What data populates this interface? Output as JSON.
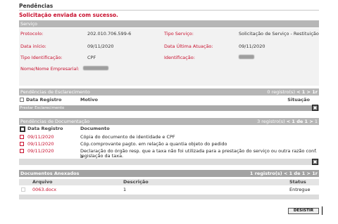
{
  "page": {
    "title": "Pendências",
    "success_message": "Solicitação enviada com sucesso."
  },
  "servico": {
    "header": "Serviço",
    "fields": {
      "protocolo_label": "Protocolo:",
      "protocolo_value": "202.010.706.599-6",
      "tipo_servico_label": "Tipo Serviço:",
      "tipo_servico_value": "Solicitação de Serviço - Restituição",
      "data_inicio_label": "Data início:",
      "data_inicio_value": "09/11/2020",
      "data_ultima_label": "Data Última Atuação:",
      "data_ultima_value": "09/11/2020",
      "tipo_ident_label": "Tipo Identificação:",
      "tipo_ident_value": "CPF",
      "identificacao_label": "Identificação:",
      "nome_label": "Nome/Nome Empresarial:"
    }
  },
  "esclarecimento": {
    "header": "Pendências de Esclarecimento",
    "pager_count": "0 registro(s) ",
    "pager_nav": "< 1 > 1r",
    "col_data": "Data Registro",
    "col_motivo": "Motivo",
    "col_situacao": "Situação",
    "action": "Prestar Esclarecimento"
  },
  "documentacao": {
    "header": "Pendências de Documentação",
    "pager_count": "3 registro(s)",
    "pager_nav": "< 1 de 1 >",
    "pager_extra": "1",
    "col_data": "Data Registro",
    "col_documento": "Documento",
    "rows": [
      {
        "date": "09/11/2020",
        "doc": "Cópia do documento de identidade e CPF"
      },
      {
        "date": "09/11/2020",
        "doc": "Cóp.comprovante pagto. em relação a quantia objeto do pedido"
      },
      {
        "date": "09/11/2020",
        "doc": "Declaração do órgão resp. que a taxa não foi utilizada para a prestação do serviço ou outra razão conf. a"
      },
      {
        "date": "",
        "doc": "legislação da taxa."
      }
    ]
  },
  "anexados": {
    "header": "Documentos Anexados",
    "pager_count": "1 registro(s)",
    "pager_nav": "< 1 de 1 >",
    "pager_extra": "1r",
    "col_arquivo": "Arquivo",
    "col_descricao": "Descrição",
    "col_status": "Status",
    "rows": [
      {
        "arquivo": "0063.docx",
        "descricao": "1",
        "status": "Entregue"
      }
    ]
  },
  "buttons": {
    "desistir": "DESISTIR"
  },
  "colors": {
    "accent_red": "#c8102e",
    "bar_grey": "#b6b6b6"
  }
}
